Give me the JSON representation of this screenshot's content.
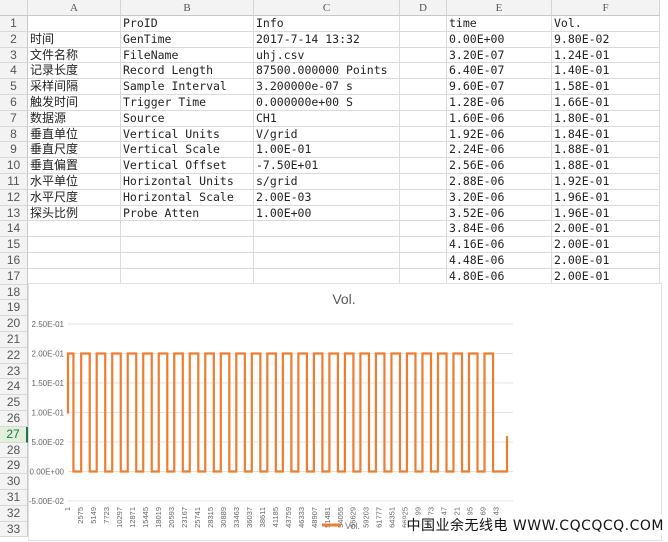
{
  "columns": [
    "A",
    "B",
    "C",
    "D",
    "E",
    "F"
  ],
  "rows": [
    [
      "",
      "ProID",
      "Info",
      "",
      "time",
      "Vol."
    ],
    [
      "时间",
      "GenTime",
      "2017-7-14 13:32",
      "",
      "0.00E+00",
      "9.80E-02"
    ],
    [
      "文件名称",
      "FileName",
      "uhj.csv",
      "",
      "3.20E-07",
      "1.24E-01"
    ],
    [
      "记录长度",
      "Record Length",
      "87500.000000 Points",
      "",
      "6.40E-07",
      "1.40E-01"
    ],
    [
      "采样间隔",
      "Sample Interval",
      "3.200000e-07 s",
      "",
      "9.60E-07",
      "1.58E-01"
    ],
    [
      "触发时间",
      "Trigger Time",
      "0.000000e+00 S",
      "",
      "1.28E-06",
      "1.66E-01"
    ],
    [
      "数据源",
      "Source",
      "CH1",
      "",
      "1.60E-06",
      "1.80E-01"
    ],
    [
      "垂直单位",
      "Vertical Units",
      "V/grid",
      "",
      "1.92E-06",
      "1.84E-01"
    ],
    [
      "垂直尺度",
      "Vertical Scale",
      "1.00E-01",
      "",
      "2.24E-06",
      "1.88E-01"
    ],
    [
      "垂直偏置",
      "Vertical Offset",
      "-7.50E+01",
      "",
      "2.56E-06",
      "1.88E-01"
    ],
    [
      "水平单位",
      "Horizontal Units",
      "s/grid",
      "",
      "2.88E-06",
      "1.92E-01"
    ],
    [
      "水平尺度",
      "Horizontal Scale",
      "2.00E-03",
      "",
      "3.20E-06",
      "1.96E-01"
    ],
    [
      "探头比例",
      "Probe Atten",
      "1.00E+00",
      "",
      "3.52E-06",
      "1.96E-01"
    ],
    [
      "",
      "",
      "",
      "",
      "3.84E-06",
      "2.00E-01"
    ],
    [
      "",
      "",
      "",
      "",
      "4.16E-06",
      "2.00E-01"
    ],
    [
      "",
      "",
      "",
      "",
      "4.48E-06",
      "2.00E-01"
    ],
    [
      "",
      "",
      "",
      "",
      "4.80E-06",
      "2.00E-01"
    ]
  ],
  "row_numbers": [
    "1",
    "2",
    "3",
    "4",
    "5",
    "6",
    "7",
    "8",
    "9",
    "10",
    "11",
    "12",
    "13",
    "14",
    "15",
    "16",
    "17",
    "18",
    "19",
    "20",
    "21",
    "22",
    "23",
    "24",
    "25",
    "26",
    "27",
    "28",
    "29",
    "30",
    "31",
    "32",
    "33"
  ],
  "selected_row": "27",
  "chart_data": {
    "type": "line",
    "title": "Vol.",
    "legend": [
      "Vol."
    ],
    "legend_position": "bottom",
    "grid": true,
    "color": "#ED7D31",
    "ylim": [
      -0.05,
      0.25
    ],
    "y_ticks": [
      "2.50E-01",
      "2.00E-01",
      "1.50E-01",
      "1.00E-01",
      "5.00E-02",
      "0.00E+00",
      "-5.00E-02"
    ],
    "y_tick_values": [
      0.25,
      0.2,
      0.15,
      0.1,
      0.05,
      0,
      -0.05
    ],
    "x_ticks": [
      "1",
      "2575",
      "5149",
      "7723",
      "10297",
      "12871",
      "15445",
      "18019",
      "20593",
      "23167",
      "25741",
      "28315",
      "30889",
      "33463",
      "36037",
      "38611",
      "41185",
      "43759",
      "46333",
      "48907",
      "51481",
      "54055",
      "56629",
      "59203",
      "61777",
      "64351",
      "66925",
      "69499",
      "72073",
      "74647",
      "77221",
      "79795",
      "82369",
      "84943"
    ],
    "xlim": [
      1,
      87500
    ],
    "series": [
      {
        "name": "Vol.",
        "waveform": "square",
        "high": 0.2,
        "low": 0.0,
        "pulses": 28,
        "first_value": 0.098,
        "last_value": 0.06
      }
    ]
  },
  "watermark": "中国业余无线电 WWW.CQCQCQ.COM"
}
